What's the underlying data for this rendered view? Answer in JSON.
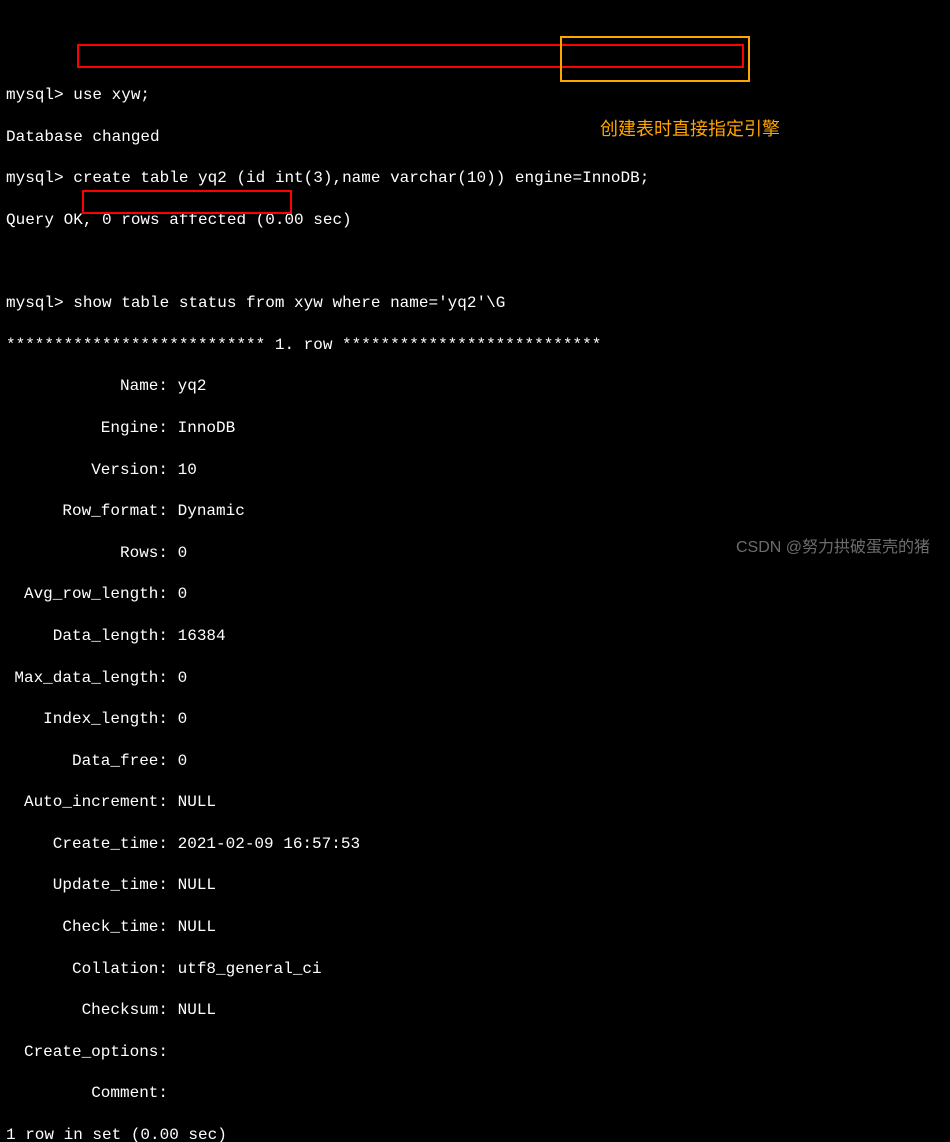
{
  "prompt": "mysql>",
  "cmd1": "use xyw;",
  "resp1": "Database changed",
  "cmd2": "create table yq2 (id int(3),name varchar(10)) engine=InnoDB;",
  "resp2": "Query OK, 0 rows affected (0.00 sec)",
  "cmd3": "show table status from xyw where name='yq2'\\G",
  "rowheader": "*************************** 1. row ***************************",
  "status": {
    "Name": "yq2",
    "Engine": "InnoDB",
    "Version": "10",
    "Row_format": "Dynamic",
    "Rows": "0",
    "Avg_row_length": "0",
    "Data_length": "16384",
    "Max_data_length": "0",
    "Index_length": "0",
    "Data_free": "0",
    "Auto_increment": "NULL",
    "Create_time": "2021-02-09 16:57:53",
    "Update_time": "NULL",
    "Check_time": "NULL",
    "Collation": "utf8_general_ci",
    "Checksum": "NULL",
    "Create_options": "",
    "Comment": ""
  },
  "footer": "1 row in set (0.00 sec)",
  "annotation": "创建表时直接指定引擎",
  "watermark": "CSDN @努力拱破蛋壳的猪"
}
